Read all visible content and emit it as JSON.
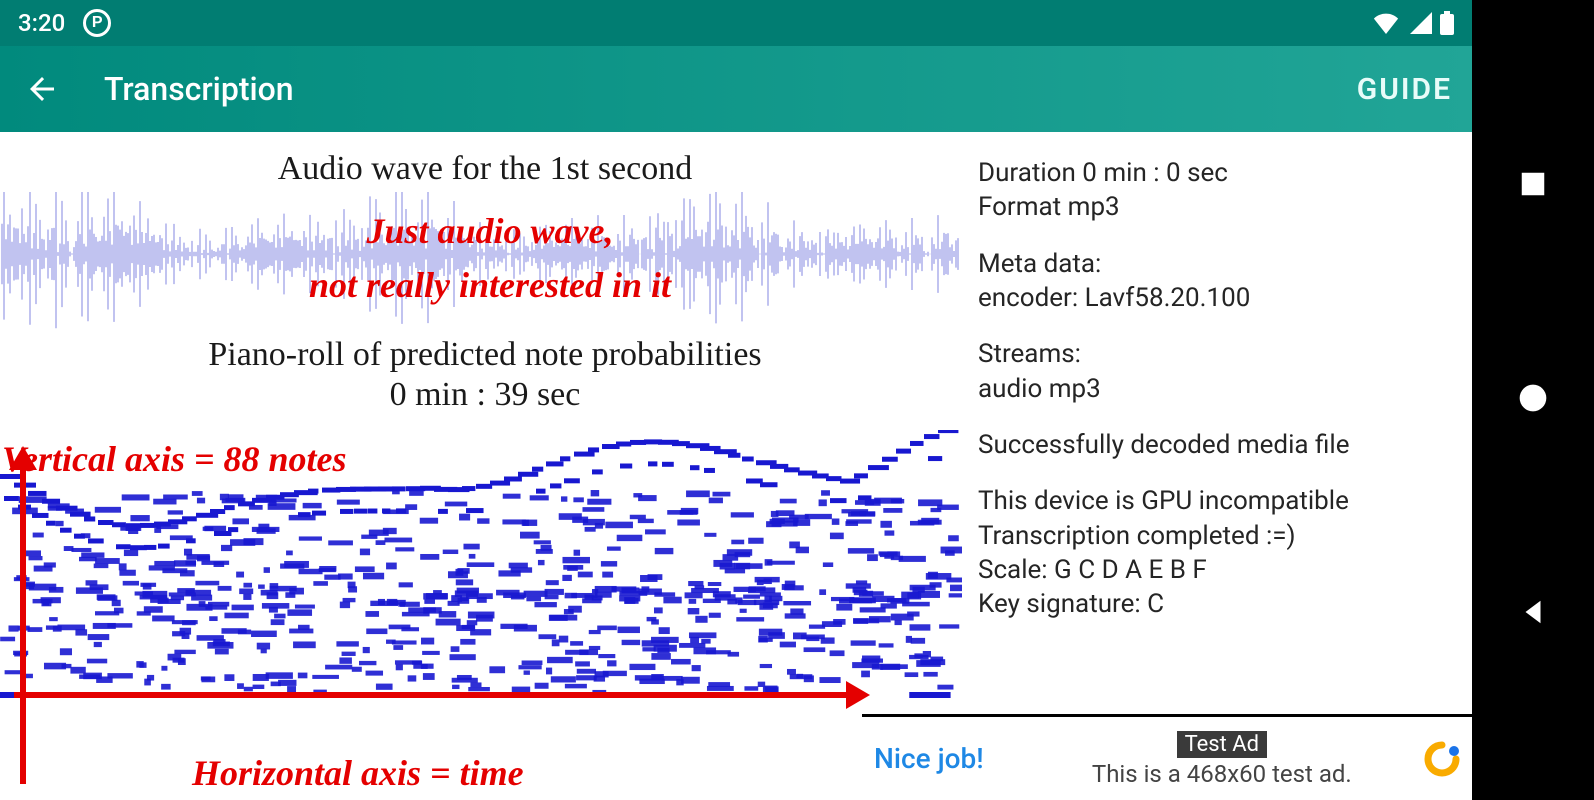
{
  "status": {
    "time": "3:20"
  },
  "appbar": {
    "title": "Transcription",
    "guide": "GUIDE"
  },
  "main": {
    "wave_title": "Audio wave for the 1st second",
    "anno_wave_l1": "Just audio wave,",
    "anno_wave_l2": "not really interested in it",
    "roll_title": "Piano-roll of predicted note probabilities",
    "roll_time": "0 min : 39 sec",
    "anno_vert": "Vertical axis = 88 notes",
    "anno_horiz": "Horizontal axis = time"
  },
  "info": {
    "duration": "Duration 0 min : 0 sec",
    "format": "Format mp3",
    "meta_label": "Meta data:",
    "encoder": "encoder: Lavf58.20.100",
    "streams_label": "Streams:",
    "streams_value": "audio mp3",
    "decoded": "Successfully decoded media file",
    "gpu": "This device is GPU incompatible",
    "completed": "Transcription completed :=)",
    "scale": "Scale:   G C D A E B F",
    "key": "Key signature: C"
  },
  "ad": {
    "nice": "Nice job!",
    "badge": "Test Ad",
    "text": "This is a 468x60 test ad."
  }
}
